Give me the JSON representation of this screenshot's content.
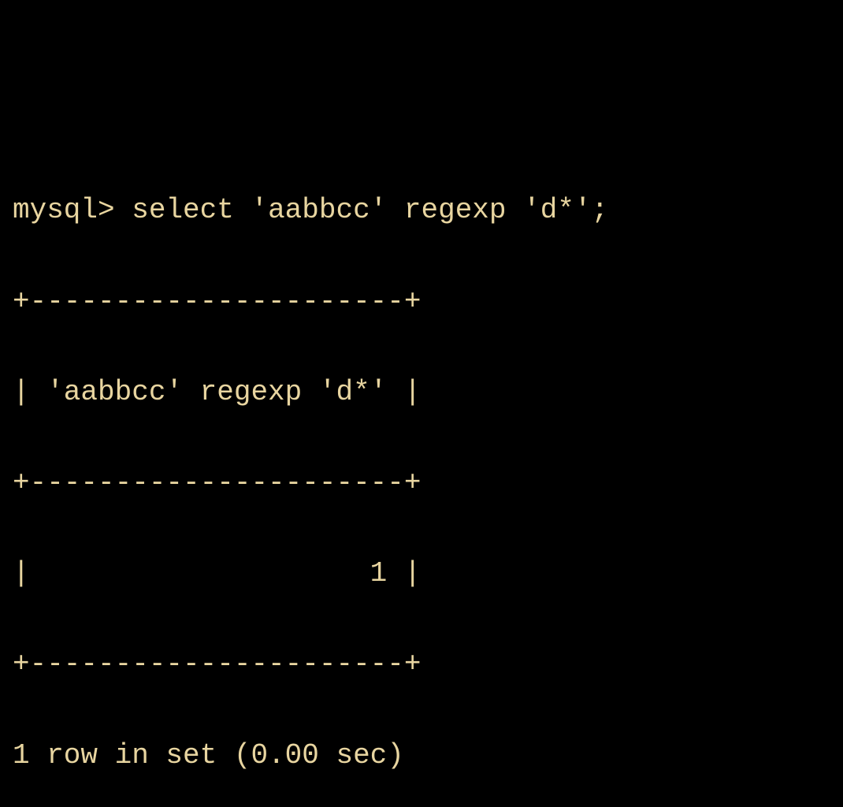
{
  "terminal": {
    "prompt": "mysql>",
    "command": "select 'aabbcc' regexp 'd*';",
    "table": {
      "border_top": "+----------------------+",
      "header_row": "| 'aabbcc' regexp 'd*' |",
      "border_mid": "+----------------------+",
      "data_row": "|                    1 |",
      "border_bottom": "+----------------------+"
    },
    "status": "1 row in set (0.00 sec)"
  }
}
